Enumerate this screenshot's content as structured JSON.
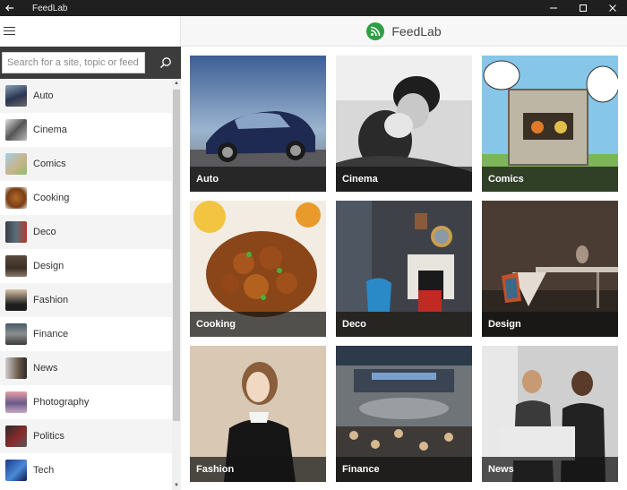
{
  "window": {
    "title": "FeedLab",
    "back_icon": "arrow-left-icon",
    "controls": [
      "minimize-icon",
      "maximize-icon",
      "close-icon"
    ]
  },
  "header": {
    "app_title": "FeedLab",
    "logo_icon": "rss-icon",
    "accent_color": "#2f9e46"
  },
  "search": {
    "placeholder": "Search for a site, topic or feed",
    "value": ""
  },
  "topics": [
    {
      "label": "Auto"
    },
    {
      "label": "Cinema"
    },
    {
      "label": "Comics"
    },
    {
      "label": "Cooking"
    },
    {
      "label": "Deco"
    },
    {
      "label": "Design"
    },
    {
      "label": "Fashion"
    },
    {
      "label": "Finance"
    },
    {
      "label": "News"
    },
    {
      "label": "Photography"
    },
    {
      "label": "Politics"
    },
    {
      "label": "Tech"
    }
  ],
  "tiles": [
    {
      "label": "Auto"
    },
    {
      "label": "Cinema"
    },
    {
      "label": "Comics"
    },
    {
      "label": "Cooking"
    },
    {
      "label": "Deco"
    },
    {
      "label": "Design"
    },
    {
      "label": "Fashion"
    },
    {
      "label": "Finance"
    },
    {
      "label": "News"
    }
  ]
}
